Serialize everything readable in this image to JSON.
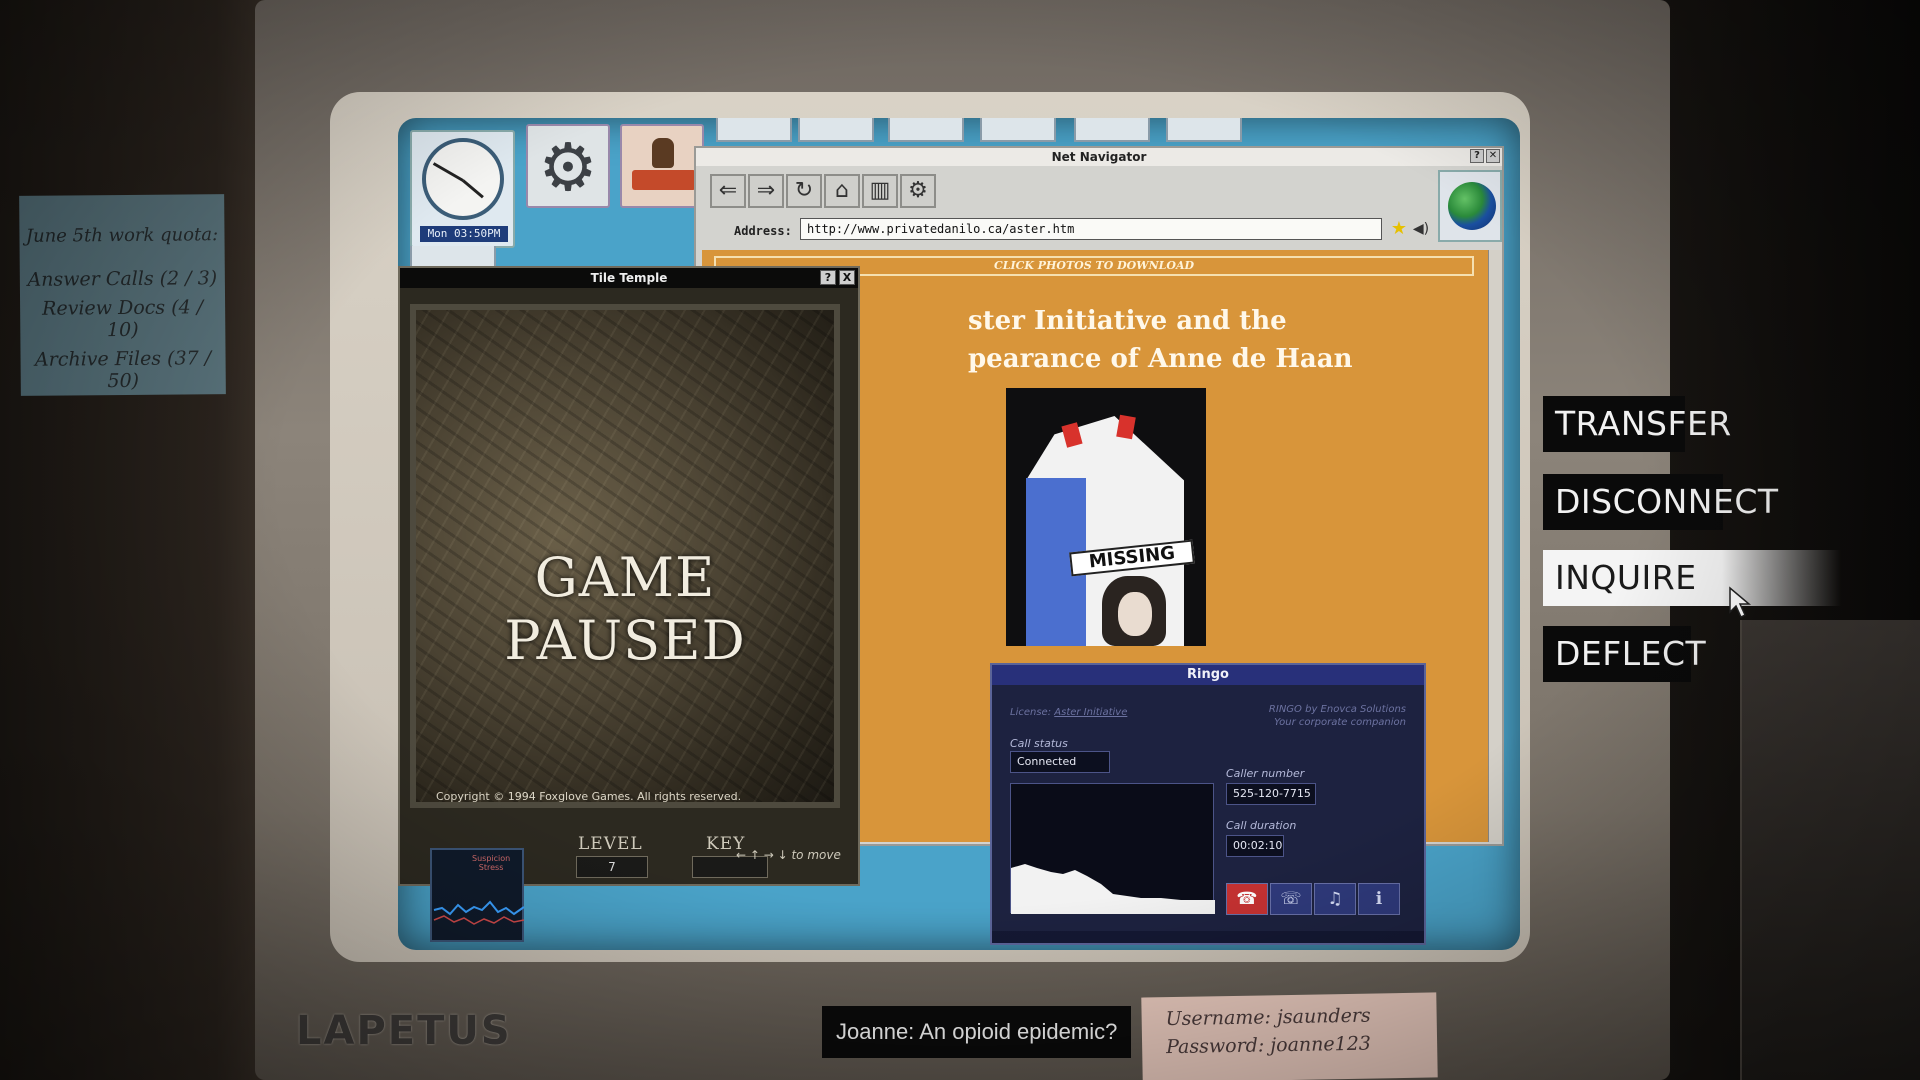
{
  "sticky_note": {
    "title": "June 5th work quota:",
    "lines": [
      "Answer Calls (2 / 3)",
      "Review Docs (4 / 10)",
      "Archive Files (37 / 50)"
    ]
  },
  "credentials": {
    "username": "Username: jsaunders",
    "password": "Password: joanne123"
  },
  "monitor": {
    "brand": "LAPETUS"
  },
  "desktop": {
    "clock_time": "Mon 03:50PM"
  },
  "browser": {
    "title": "Net Navigator",
    "address_label": "Address:",
    "address": "http://www.privatedanilo.ca/aster.htm",
    "banner": "CLICK PHOTOS TO DOWNLOAD",
    "headline_line1": "ster Initiative and the",
    "headline_line2": "pearance of Anne de Haan",
    "photo_label": "MISSING"
  },
  "game": {
    "title": "Tile Temple",
    "help_btn": "?",
    "close_btn": "X",
    "status": "GAME PAUSED",
    "copyright": "Copyright © 1994 Foxglove Games. All rights reserved.",
    "level_label": "LEVEL",
    "level_value": "7",
    "key_label": "KEY",
    "hint": "← ↑ → ↓ to move"
  },
  "stress_meter": {
    "label_top": "Suspicion",
    "label_bottom": "Stress"
  },
  "ringo": {
    "title": "Ringo",
    "license_prefix": "License:",
    "license_name": "Aster Initiative",
    "brand_line1": "RINGO by Enovca Solutions",
    "brand_line2": "Your corporate companion",
    "call_status_label": "Call status",
    "call_status": "Connected",
    "caller_number_label": "Caller number",
    "caller_number": "525-120-7715",
    "call_duration_label": "Call duration",
    "call_duration": "00:02:10"
  },
  "dialogue_options": [
    "TRANSFER",
    "DISCONNECT",
    "INQUIRE",
    "DEFLECT"
  ],
  "selected_option": "INQUIRE",
  "subtitle": "Joanne: An opioid epidemic?"
}
